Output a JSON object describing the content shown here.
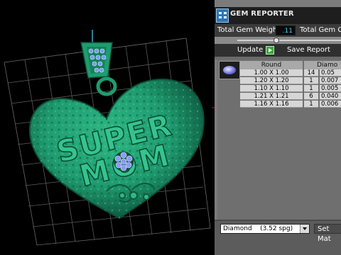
{
  "panel": {
    "title": "GEM REPORTER",
    "total_gem_weight_label": "Total Gem Weight",
    "total_gem_weight_value": ".11",
    "total_gem_count_label": "Total Gem C",
    "update_label": "Update",
    "save_report_label": "Save Report",
    "table": {
      "headers": [
        "Round",
        "Diamo"
      ],
      "rows": [
        {
          "size": "1.00 X 1.00",
          "qty": "14",
          "weight": "0.05"
        },
        {
          "size": "1.20 X 1.20",
          "qty": "1",
          "weight": "0.007"
        },
        {
          "size": "1.10 X 1.10",
          "qty": "1",
          "weight": "0.005"
        },
        {
          "size": "1.21 X 1.21",
          "qty": "6",
          "weight": "0.040"
        },
        {
          "size": "1.16 X 1.16",
          "qty": "1",
          "weight": "0.006"
        }
      ]
    },
    "material_select": "Diamond    (3.52 spg)",
    "set_material_label": "Set Mat"
  },
  "viewport": {
    "text_line1": "SUPER",
    "text_line2": "MOM"
  },
  "colors": {
    "pendant": "#1f9c70",
    "pendant_dark": "#0b4e38",
    "grid": "#5a5a5a",
    "weight_value": "#36d6f0",
    "gem": "#7a8cf0"
  }
}
